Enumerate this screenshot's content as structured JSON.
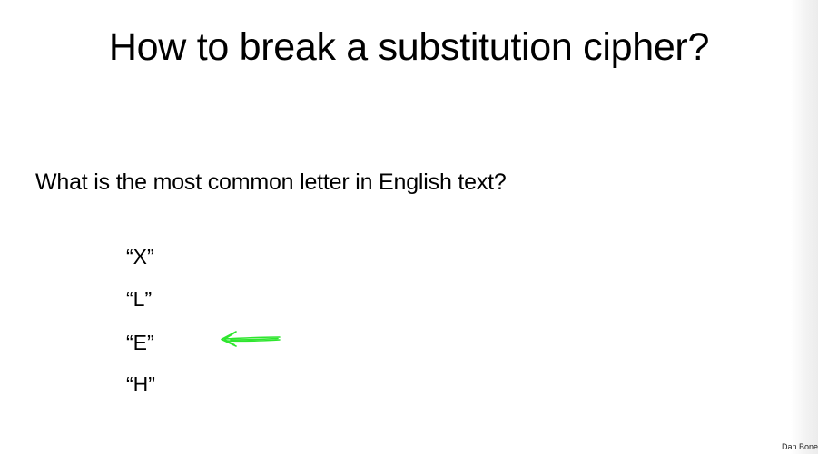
{
  "slide": {
    "title": "How to break a substitution cipher?",
    "question": "What is the most common letter in English text?",
    "options": [
      "“X”",
      "“L”",
      "“E”",
      "“H”"
    ],
    "highlighted_option": "“E”",
    "annotation": {
      "icon": "hand-drawn-arrow-left-icon",
      "color": "#2ee62e"
    },
    "footer": "Dan Bone"
  }
}
